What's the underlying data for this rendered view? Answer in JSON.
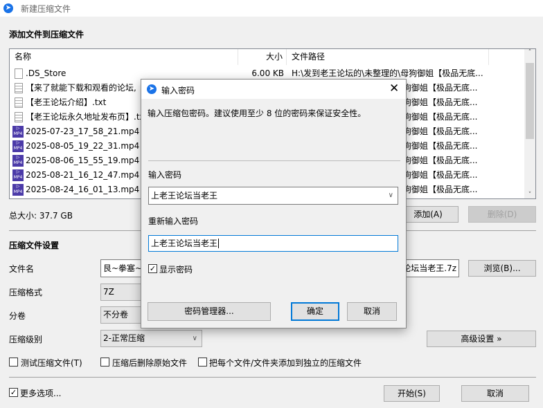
{
  "window": {
    "title": "新建压缩文件"
  },
  "add_section": {
    "label": "添加文件到压缩文件"
  },
  "file_list": {
    "columns": {
      "name": "名称",
      "size": "大小",
      "path": "文件路径"
    },
    "rows": [
      {
        "name": ".DS_Store",
        "size": "6.00 KB",
        "path": "H:\\发到老王论坛的\\未整理的\\母狗御姐【极品无底...",
        "icon": "file-icon"
      },
      {
        "name": "【来了就能下载和观看的论坛,",
        "size": "",
        "path": "母狗御姐【极品无底...",
        "icon": "text-file-icon"
      },
      {
        "name": "【老王论坛介绍】.txt",
        "size": "",
        "path": "母狗御姐【极品无底...",
        "icon": "text-file-icon"
      },
      {
        "name": "【老王论坛永久地址发布页】.tx",
        "size": "",
        "path": "母狗御姐【极品无底...",
        "icon": "text-file-icon"
      },
      {
        "name": "2025-07-23_17_58_21.mp4",
        "size": "",
        "path": "母狗御姐【极品无底...",
        "icon": "mp4-icon"
      },
      {
        "name": "2025-08-05_19_22_31.mp4",
        "size": "",
        "path": "母狗御姐【极品无底...",
        "icon": "mp4-icon"
      },
      {
        "name": "2025-08-06_15_55_19.mp4",
        "size": "",
        "path": "母狗御姐【极品无底...",
        "icon": "mp4-icon"
      },
      {
        "name": "2025-08-21_16_12_47.mp4",
        "size": "",
        "path": "母狗御姐【极品无底...",
        "icon": "mp4-icon"
      },
      {
        "name": "2025-08-24_16_01_13.mp4",
        "size": "",
        "path": "母狗御姐【极品无底...",
        "icon": "mp4-icon"
      }
    ]
  },
  "total_size": "总大小: 37.7 GB",
  "buttons": {
    "add": "添加(A)",
    "delete": "删除(D)",
    "browse": "浏览(B)...",
    "advanced": "高级设置 »",
    "start": "开始(S)",
    "cancel": "取消"
  },
  "settings": {
    "label": "压缩文件设置",
    "filename_label": "文件名",
    "filename_left": "艮~拳塞~咿",
    "filename_right": "论坛当老王.7z",
    "format_label": "压缩格式",
    "format_value": "7Z",
    "volume_label": "分卷",
    "volume_value": "不分卷",
    "level_label": "压缩级别",
    "level_value": "2-正常压缩",
    "test_archive": {
      "label": "测试压缩文件(T)",
      "checked": false
    },
    "delete_after": {
      "label": "压缩后删除原始文件",
      "checked": false
    },
    "separate": {
      "label": "把每个文件/文件夹添加到独立的压缩文件",
      "checked": false
    },
    "more_options": {
      "label": "更多选项...",
      "checked": true
    }
  },
  "dialog": {
    "title": "输入密码",
    "hint": "输入压缩包密码。建议使用至少 8 位的密码来保证安全性。",
    "password_label": "输入密码",
    "password_value": "上老王论坛当老王",
    "confirm_label": "重新输入密码",
    "confirm_value": "上老王论坛当老王",
    "show_password": {
      "label": "显示密码",
      "checked": true
    },
    "manager": "密码管理器...",
    "ok": "确定",
    "cancel": "取消"
  }
}
